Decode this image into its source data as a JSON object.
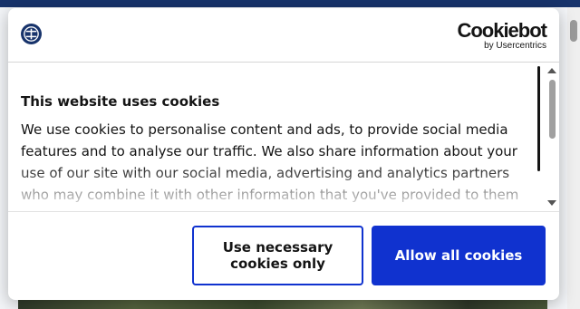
{
  "dialog": {
    "brand_name": "Cookiebot",
    "brand_sub": "by Usercentrics",
    "title": "This website uses cookies",
    "body": "We use cookies to personalise content and ads, to provide social media features and to analyse our traffic. We also share information about your use of our site with our social media, advertising and analytics partners who may combine it with other information that you've provided to them",
    "buttons": {
      "necessary": "Use necessary cookies only",
      "allow": "Allow all cookies"
    }
  },
  "colors": {
    "accent": "#1032cf",
    "header_bar": "#17336b",
    "text": "#141414"
  },
  "icons": {
    "site_logo": "site-logo-icon",
    "scroll_up": "chevron-up-icon",
    "scroll_down": "chevron-down-icon"
  }
}
